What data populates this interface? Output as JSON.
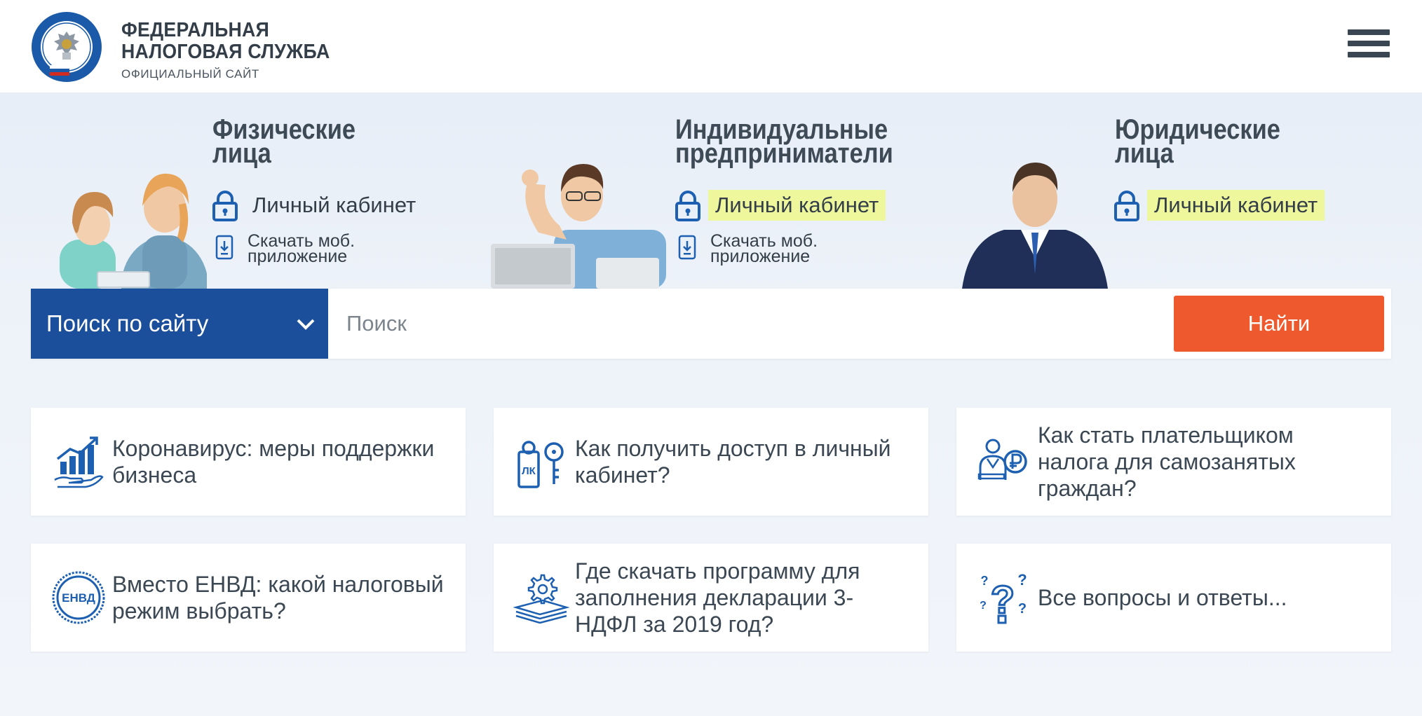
{
  "header": {
    "brand_line1": "ФЕДЕРАЛЬНАЯ",
    "brand_line2": "НАЛОГОВАЯ СЛУЖБА",
    "brand_sub": "ОФИЦИАЛЬНЫЙ САЙТ",
    "emblem_text": "ФЕДЕРАЛЬНАЯ НАЛОГОВАЯ СЛУЖБА"
  },
  "categories": [
    {
      "title_line1": "Физические",
      "title_line2": "лица",
      "cabinet": "Личный кабинет",
      "download_line1": "Скачать моб.",
      "download_line2": "приложение"
    },
    {
      "title_line1": "Индивидуальные",
      "title_line2": "предприниматели",
      "cabinet": "Личный кабинет",
      "download_line1": "Скачать моб.",
      "download_line2": "приложение"
    },
    {
      "title_line1": "Юридические",
      "title_line2": "лица",
      "cabinet": "Личный кабинет"
    }
  ],
  "search": {
    "select_label": "Поиск по сайту",
    "placeholder": "Поиск",
    "button_label": "Найти"
  },
  "cards": [
    {
      "text": "Коронавирус: меры поддержки бизнеса",
      "icon": "growth-chart-icon"
    },
    {
      "text": "Как получить доступ в личный кабинет?",
      "icon": "lk-key-icon",
      "icon_text": "ЛК"
    },
    {
      "text": "Как стать плательщиком налога для самозанятых граждан?",
      "icon": "self-employed-icon"
    },
    {
      "text": "Вместо ЕНВД: какой налоговый режим выбрать?",
      "icon": "envd-seal-icon",
      "icon_text": "ЕНВД"
    },
    {
      "text": "Где скачать программу для заполнения декларации 3-НДФЛ за 2019 год?",
      "icon": "gear-documents-icon"
    },
    {
      "text": "Все вопросы и ответы...",
      "icon": "questions-icon"
    }
  ],
  "colors": {
    "brand_blue": "#1b4e9b",
    "accent_orange": "#ee5a2d",
    "highlight_yellow": "#eef79c",
    "icon_blue": "#1d5fb0",
    "text_dark": "#333e48"
  }
}
